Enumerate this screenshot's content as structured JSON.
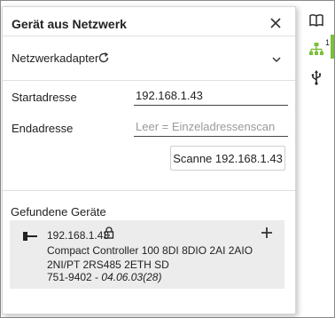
{
  "dialog": {
    "title": "Gerät aus Netzwerk",
    "adapter_label": "Netzwerkadapter",
    "start_label": "Startadresse",
    "start_value": "192.168.1.43",
    "end_label": "Endadresse",
    "end_placeholder": "Leer = Einzeladressenscan",
    "scan_button": "Scanne 192.168.1.43",
    "found_title": "Gefundene Geräte"
  },
  "device": {
    "ip": "192.168.1.43",
    "name": "Compact Controller 100 8DI 8DIO 2AI 2AIO 2NI/PT 2RS485 2ETH SD",
    "article": "751-9402 - ",
    "version": "04.06.03(28)"
  },
  "sidebar": {
    "network_badge": "1",
    "items": [
      "book-icon",
      "network-icon",
      "usb-icon"
    ]
  },
  "colors": {
    "accent": "#7bbf3a",
    "card_bg": "#ececec",
    "text": "#222222"
  }
}
